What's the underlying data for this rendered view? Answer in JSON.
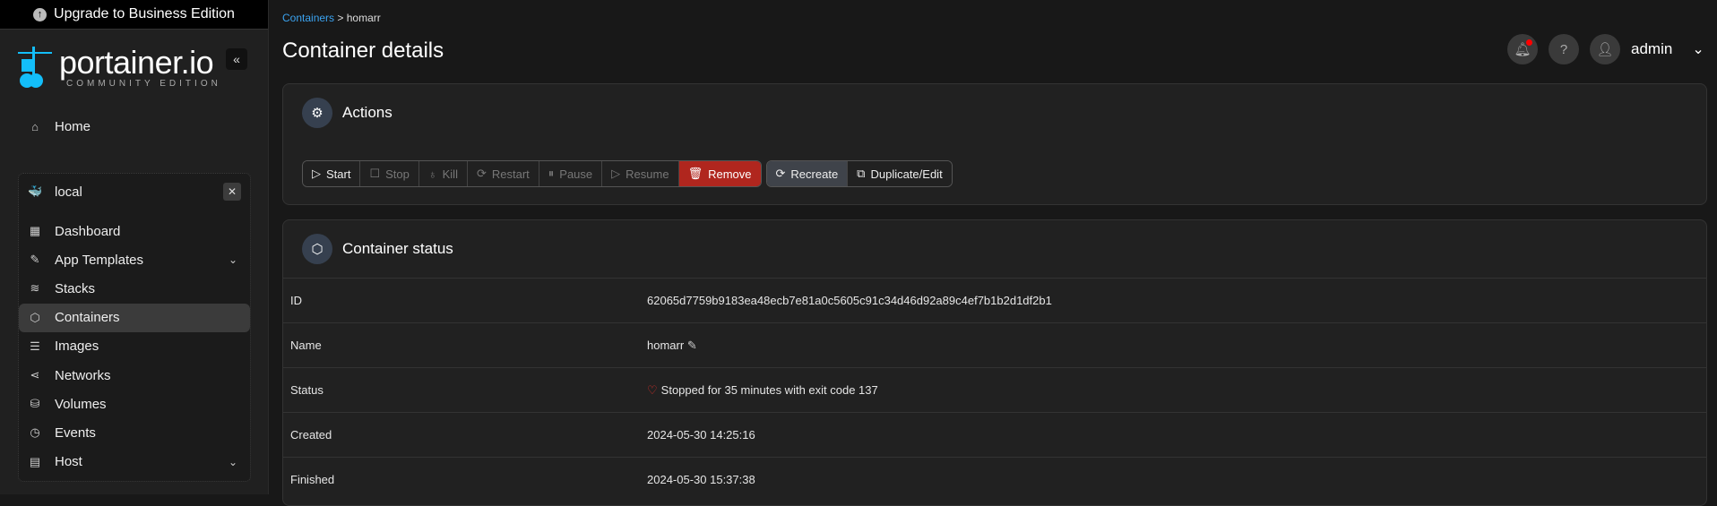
{
  "upgrade_label": "Upgrade to Business Edition",
  "logo": {
    "name": "portainer.io",
    "edition": "COMMUNITY EDITION"
  },
  "sidebar": {
    "home": "Home",
    "environment": "local",
    "items": [
      {
        "label": "Dashboard",
        "icon": "dashboard-icon"
      },
      {
        "label": "App Templates",
        "icon": "edit-icon",
        "chevron": true
      },
      {
        "label": "Stacks",
        "icon": "layers-icon"
      },
      {
        "label": "Containers",
        "icon": "box-icon",
        "active": true
      },
      {
        "label": "Images",
        "icon": "list-icon"
      },
      {
        "label": "Networks",
        "icon": "share-icon"
      },
      {
        "label": "Volumes",
        "icon": "database-icon"
      },
      {
        "label": "Events",
        "icon": "clock-icon"
      },
      {
        "label": "Host",
        "icon": "host-icon",
        "chevron": true
      }
    ]
  },
  "breadcrumb": {
    "parent": "Containers",
    "sep": ">",
    "current": "homarr"
  },
  "page_title": "Container details",
  "user": "admin",
  "actions": {
    "title": "Actions",
    "buttons": [
      "Start",
      "Stop",
      "Kill",
      "Restart",
      "Pause",
      "Resume",
      "Remove"
    ],
    "buttons2": [
      "Recreate",
      "Duplicate/Edit"
    ]
  },
  "status": {
    "title": "Container status",
    "rows": [
      {
        "key": "ID",
        "value": "62065d7759b9183ea48ecb7e81a0c5605c91c34d46d92a89c4ef7b1b2d1df2b1"
      },
      {
        "key": "Name",
        "value": "homarr"
      },
      {
        "key": "Status",
        "value": "Stopped for 35 minutes with exit code 137"
      },
      {
        "key": "Created",
        "value": "2024-05-30 14:25:16"
      },
      {
        "key": "Finished",
        "value": "2024-05-30 15:37:38"
      }
    ]
  },
  "colors": {
    "accent": "#3ba3f0",
    "danger": "#b0261e"
  }
}
